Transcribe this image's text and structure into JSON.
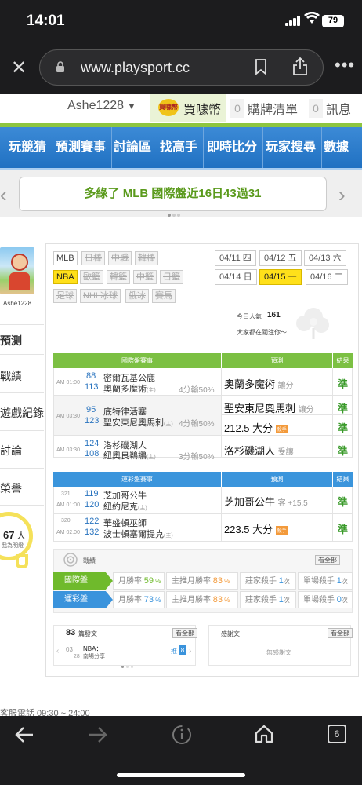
{
  "status": {
    "time": "14:01",
    "battery": "79"
  },
  "browser": {
    "url": "www.playsport.cc"
  },
  "userbar": {
    "username": "Ashe1228",
    "buycoin_label": "買噱幣",
    "coin_icon_text": "買噱幣",
    "cart_count": "0",
    "cart_label": "購牌清單",
    "msg_count": "0",
    "msg_label": "訊息"
  },
  "nav": {
    "items": [
      "玩競猜",
      "預測賽事",
      "討論區",
      "找高手",
      "即時比分",
      "玩家搜尋",
      "數據"
    ]
  },
  "banner": {
    "text": "多綠了 MLB 國際盤近16日43過31",
    "prev": "‹",
    "next": "›"
  },
  "sidebar": {
    "avatar_name": "Ashe1228",
    "active_item": "預測",
    "items": [
      "戰績",
      "遊戲紀錄",
      "討論",
      "榮譽"
    ],
    "popularity_count": "67",
    "popularity_unit": "人",
    "popularity_caption": "我為明燈"
  },
  "filters": {
    "sports_row1": [
      "MLB",
      "日棒",
      "中職",
      "韓棒"
    ],
    "sports_row2": [
      "NBA",
      "歐籃",
      "韓籃",
      "中籃",
      "日籃"
    ],
    "sports_row3": [
      "足球",
      "NHL冰球",
      "俄冰",
      "賽馬"
    ],
    "dates_row1": [
      "04/11 四",
      "04/12 五",
      "04/13 六"
    ],
    "dates_row2": [
      "04/14 日",
      "04/15 一",
      "04/16 二"
    ]
  },
  "popularity": {
    "label": "今日人氣",
    "value": "161",
    "caption": "大家都在關注你～"
  },
  "intl_table": {
    "headers": [
      "國際盤賽事",
      "預測",
      "結果"
    ],
    "games": [
      {
        "time": "AM 01:00",
        "away_num": "88",
        "away": "密爾瓦基公鹿",
        "home_num": "113",
        "home": "奧蘭多魔術",
        "home_tag": "(主)",
        "odds": "4分輸50%",
        "picks": [
          {
            "text": "奧蘭多魔術",
            "sub": "讓分",
            "badge": ""
          }
        ],
        "results": [
          "準"
        ]
      },
      {
        "time": "AM 03:30",
        "away_num": "95",
        "away": "底特律活塞",
        "home_num": "123",
        "home": "聖安東尼奧馬刺",
        "home_tag": "(主)",
        "odds": "4分輸50%",
        "picks": [
          {
            "text": "聖安東尼奧馬刺",
            "sub": "讓分",
            "badge": ""
          },
          {
            "text": "212.5 大分",
            "sub": "",
            "badge": "殺手"
          }
        ],
        "results": [
          "準",
          "準"
        ]
      },
      {
        "time": "AM 03:30",
        "away_num": "124",
        "away": "洛杉磯湖人",
        "home_num": "108",
        "home": "紐奧良鵜鶘",
        "home_tag": "(主)",
        "odds": "3分輸50%",
        "picks": [
          {
            "text": "洛杉磯湖人",
            "sub": "受讓",
            "badge": ""
          }
        ],
        "results": [
          "準"
        ]
      }
    ]
  },
  "sports_table": {
    "headers": [
      "運彩盤賽事",
      "預測",
      "結果"
    ],
    "games": [
      {
        "code": "321",
        "time": "AM 01:00",
        "away_num": "119",
        "away": "芝加哥公牛",
        "home_num": "120",
        "home": "紐約尼克",
        "home_tag": "(主)",
        "pick": "芝加哥公牛",
        "pick_sub": "客 +15.5",
        "badge": "",
        "result": "準"
      },
      {
        "code": "320",
        "time": "AM 02:00",
        "away_num": "122",
        "away": "華盛頓巫師",
        "home_num": "132",
        "home": "波士頓塞爾提克",
        "home_tag": "(主)",
        "pick": "223.5 大分",
        "pick_sub": "",
        "badge": "殺手",
        "result": "準"
      }
    ]
  },
  "record": {
    "title": "戰績",
    "view_all": "看全部",
    "rows": [
      {
        "label": "國際盤",
        "color": "#6fba2c",
        "monthly": "月勝率",
        "monthly_val": "59",
        "main": "主推月勝率",
        "main_val": "83",
        "killer": "莊家殺手",
        "killer_val": "1",
        "single": "單場殺手",
        "single_val": "1",
        "unit": "次"
      },
      {
        "label": "運彩盤",
        "color": "#3a93dc",
        "monthly": "月勝率",
        "monthly_val": "73",
        "main": "主推月勝率",
        "main_val": "83",
        "killer": "莊家殺手",
        "killer_val": "1",
        "single": "單場殺手",
        "single_val": "0",
        "unit": "次"
      }
    ]
  },
  "posts": {
    "count": "83",
    "title": "篇發文",
    "view_all": "看全部",
    "item_month": "03",
    "item_day": "28",
    "item_tag": "NBA：",
    "item_title": "南場分享",
    "push_label": "推",
    "push_count": "8",
    "fav_title": "感謝文",
    "fav_view_all": "看全部",
    "fav_empty": "無感謝文"
  },
  "footer": {
    "service": "客服電話 09:30 ~ 24:00"
  },
  "toolbar": {
    "tabs_count": "6"
  }
}
